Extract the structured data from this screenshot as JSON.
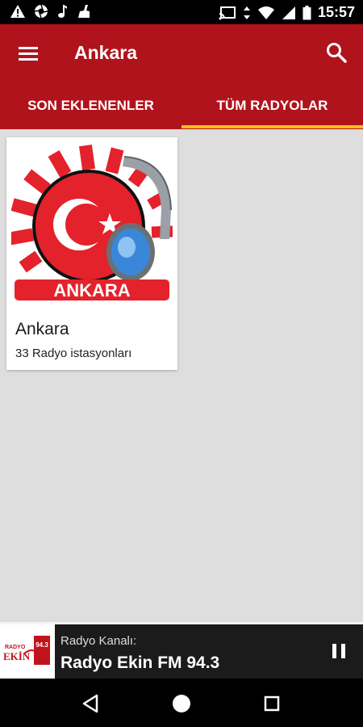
{
  "status_bar": {
    "time": "15:57",
    "left_icons": [
      "warning-icon",
      "aperture-icon",
      "music-note-icon",
      "cleaner-icon"
    ],
    "right_icons": [
      "cast-icon",
      "data-arrows-icon",
      "wifi-icon",
      "signal-icon",
      "battery-icon"
    ]
  },
  "app_bar": {
    "title": "Ankara",
    "menu_icon": "menu-icon",
    "search_icon": "search-icon"
  },
  "tabs": [
    {
      "label": "SON EKLENENLER",
      "selected": false
    },
    {
      "label": "TÜM RADYOLAR",
      "selected": true
    }
  ],
  "colors": {
    "primary": "#b0131c",
    "tab_indicator": "#f2c21b",
    "background": "#dedede",
    "player_bg": "#1b1b1b"
  },
  "cards": [
    {
      "logo_text": "ANKARA",
      "title": "Ankara",
      "subtitle": "33 Radyo istasyonları"
    }
  ],
  "player": {
    "label": "Radyo Kanalı:",
    "station": "Radyo Ekin FM 94.3",
    "logo_text_1": "RADYO",
    "logo_text_2": "EKİN",
    "logo_freq": "94.3",
    "pause_icon": "pause-icon"
  },
  "nav_bar": {
    "icons": [
      "back-icon",
      "home-icon",
      "recents-icon"
    ]
  }
}
